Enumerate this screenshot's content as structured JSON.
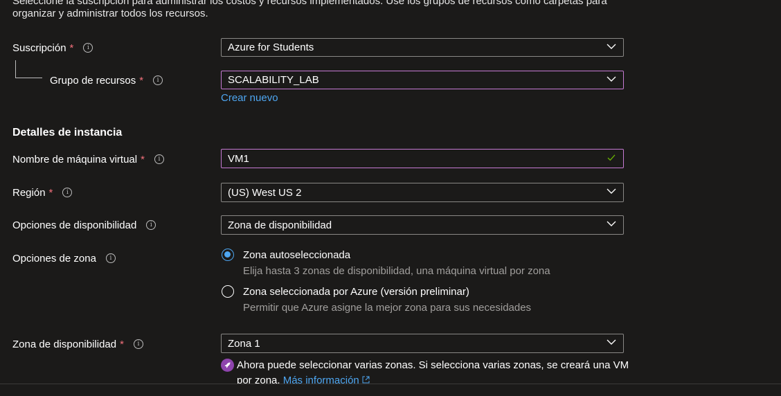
{
  "intro": {
    "cut_text": "Seleccione la suscripción para administrar los costos y recursos implementados. Use los grupos de recursos como carpetas para",
    "text": "organizar y administrar todos los recursos."
  },
  "subscription": {
    "label": "Suscripción",
    "required": "*",
    "value": "Azure for Students"
  },
  "resource_group": {
    "label": "Grupo de recursos",
    "required": "*",
    "value": "SCALABILITY_LAB",
    "create_link": "Crear nuevo"
  },
  "instance_section": {
    "title": "Detalles de instancia"
  },
  "vm_name": {
    "label": "Nombre de máquina virtual",
    "required": "*",
    "value": "VM1"
  },
  "region": {
    "label": "Región",
    "required": "*",
    "value": "(US) West US 2"
  },
  "availability_options": {
    "label": "Opciones de disponibilidad",
    "value": "Zona de disponibilidad"
  },
  "zone_options": {
    "label": "Opciones de zona",
    "options": [
      {
        "title": "Zona autoseleccionada",
        "description": "Elija hasta 3 zonas de disponibilidad, una máquina virtual por zona",
        "selected": true
      },
      {
        "title": "Zona seleccionada por Azure (versión preliminar)",
        "description": "Permitir que Azure asigne la mejor zona para sus necesidades",
        "selected": false
      }
    ]
  },
  "availability_zone": {
    "label": "Zona de disponibilidad",
    "required": "*",
    "value": "Zona 1"
  },
  "notice": {
    "line1": "Ahora puede seleccionar varias zonas. Si selecciona varias zonas, se creará una VM",
    "line2": "por zona.",
    "link": "Más información"
  },
  "colors": {
    "background": "#1b1a19",
    "required": "#f1707b",
    "link": "#4ea6f1",
    "focus_border": "#c77bd4",
    "valid_check": "#6bb700",
    "notice_icon": "#8e44ad"
  }
}
